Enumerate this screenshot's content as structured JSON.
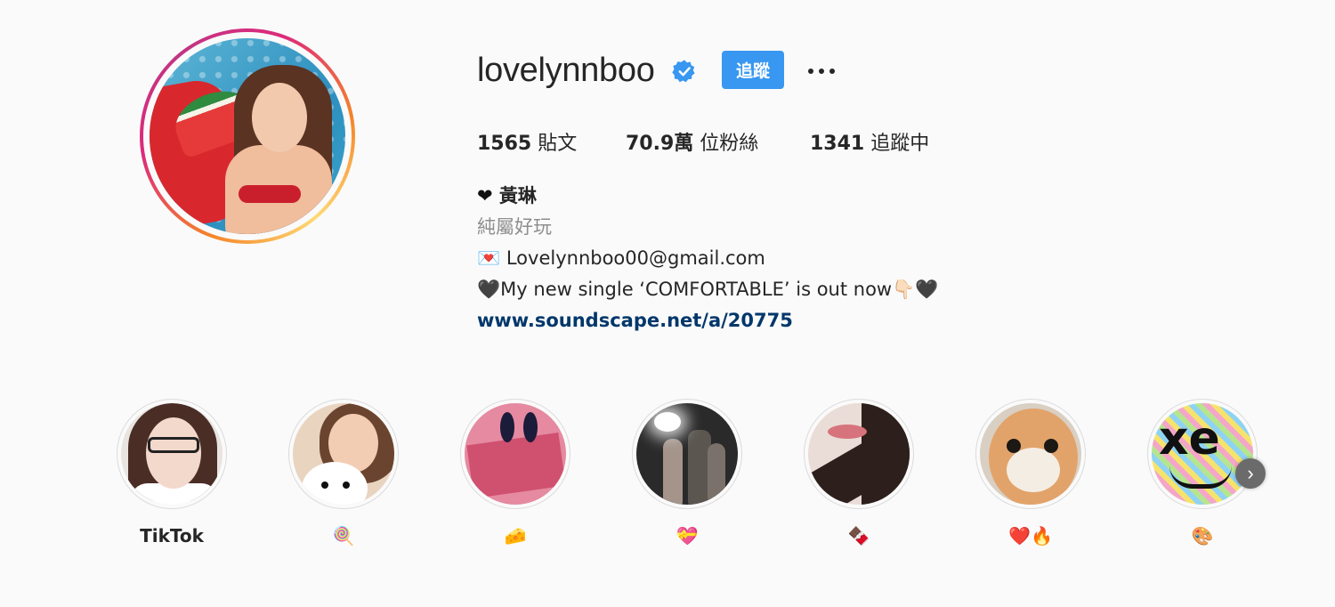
{
  "profile": {
    "username": "lovelynnboo",
    "follow_label": "追蹤",
    "stats": {
      "posts_count": "1565",
      "posts_label": "貼文",
      "followers_count": "70.9萬",
      "followers_label": "位粉絲",
      "following_count": "1341",
      "following_label": "追蹤中"
    },
    "bio": {
      "name_prefix": "❤",
      "name": "黃琳",
      "category": "純屬好玩",
      "email_icon": "💌",
      "email": "Lovelynnboo00@gmail.com",
      "line_prefix": "🖤",
      "line_text": "My new single ‘COMFORTABLE’ is out now",
      "line_suffix": "👇🏻🖤",
      "link": "www.soundscape.net/a/20775"
    }
  },
  "highlights": [
    {
      "label": "TikTok"
    },
    {
      "label": "🍭"
    },
    {
      "label": "🧀"
    },
    {
      "label": "💝"
    },
    {
      "label": "🍫"
    },
    {
      "label": "❤️🔥"
    },
    {
      "label": "🎨"
    }
  ],
  "colors": {
    "accent": "#3897f0",
    "link": "#00376b",
    "secondary_text": "#8e8e8e",
    "background": "#fafafa"
  },
  "icons": {
    "verified": "verified-badge-icon",
    "more": "more-options-icon",
    "next": "chevron-right-icon"
  }
}
